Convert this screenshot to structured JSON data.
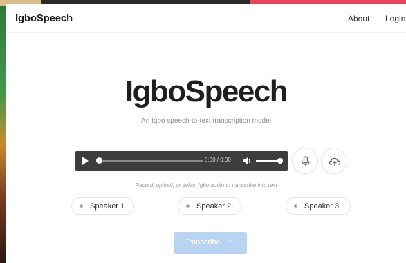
{
  "nav": {
    "brand": "IgboSpeech",
    "about": "About",
    "login": "Login"
  },
  "hero": {
    "title": "IgboSpeech",
    "subtitle": "An Igbo speech-to-text transcription model"
  },
  "player": {
    "time": "0:00 / 0:00"
  },
  "hint": "Record, upload, or select Igbo audio to transcribe into text",
  "speakers": [
    {
      "label": "Speaker 1",
      "icon": "speaker-icon"
    },
    {
      "label": "Speaker 2",
      "icon": "speaker-icon"
    },
    {
      "label": "Speaker 3",
      "icon": "speaker-icon"
    }
  ],
  "transcribe": {
    "label": "Transcribe",
    "icon": "sparkle-icon"
  },
  "colors": {
    "accent": "#b9d3f2",
    "player_bg": "#3d3d3d"
  }
}
